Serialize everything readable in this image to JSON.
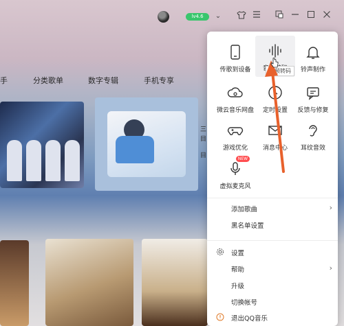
{
  "topbar": {
    "vip_label": "lv4.6",
    "icons": [
      "avatar",
      "chevron-down-icon",
      "tshirt-icon",
      "menu-icon",
      "mini-mode-icon",
      "minimize-icon",
      "maximize-icon",
      "close-icon"
    ]
  },
  "nav": {
    "items": [
      "手",
      "分类歌单",
      "数字专辑",
      "手机专享"
    ]
  },
  "content": {
    "side_text_1": "三",
    "side_text_2": "目",
    "side_text_3": "目"
  },
  "menu": {
    "grid": [
      {
        "label": "传歌到设备",
        "icon": "phone-icon"
      },
      {
        "label": "音频转码",
        "icon": "sound-wave-icon"
      },
      {
        "label": "铃声制作",
        "icon": "bell-icon"
      },
      {
        "label": "微云音乐网盘",
        "icon": "cloud-icon"
      },
      {
        "label": "定时设置",
        "icon": "clock-icon"
      },
      {
        "label": "反馈与修复",
        "icon": "feedback-icon"
      },
      {
        "label": "游戏优化",
        "icon": "gamepad-icon"
      },
      {
        "label": "消息中心",
        "icon": "mail-icon"
      },
      {
        "label": "耳纹音效",
        "icon": "ear-icon"
      },
      {
        "label": "虚拟麦克风",
        "icon": "microphone-icon"
      }
    ],
    "tooltip": "音频转码",
    "new_badge": "NEW",
    "list_top": [
      {
        "label": "添加歌曲",
        "has_submenu": true
      },
      {
        "label": "黑名单设置",
        "has_submenu": false
      }
    ],
    "list_bottom": [
      {
        "label": "设置",
        "icon": "gear-icon",
        "has_submenu": false
      },
      {
        "label": "帮助",
        "icon": "",
        "has_submenu": true
      },
      {
        "label": "升级",
        "icon": "",
        "has_submenu": false
      },
      {
        "label": "切换帐号",
        "icon": "",
        "has_submenu": false
      },
      {
        "label": "退出QQ音乐",
        "icon": "exit-icon",
        "has_submenu": false
      }
    ]
  },
  "colors": {
    "vip_green": "#39c66d",
    "arrow_orange": "#e8612c",
    "new_red": "#ff4d4f",
    "menu_bg": "#ffffff"
  }
}
